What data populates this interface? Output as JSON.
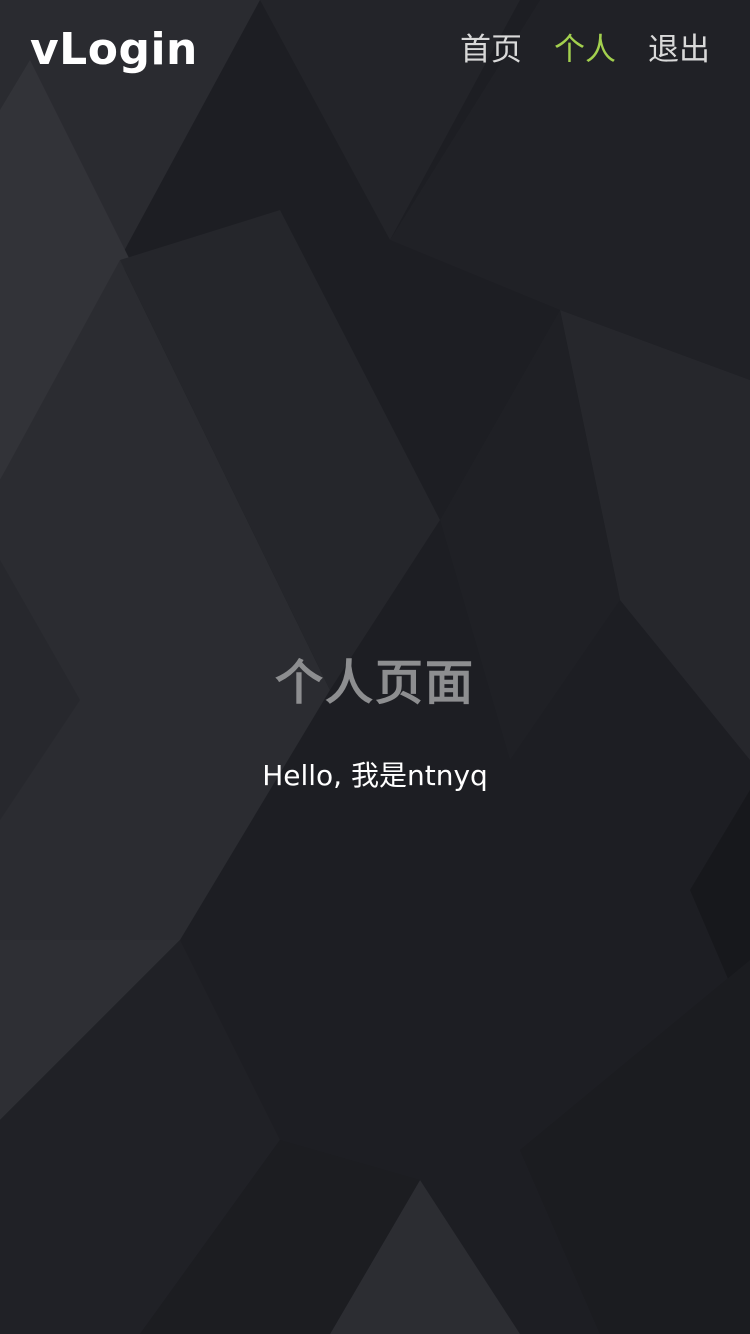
{
  "header": {
    "brand": "vLogin",
    "nav": [
      {
        "label": "首页",
        "active": false
      },
      {
        "label": "个人",
        "active": true
      },
      {
        "label": "退出",
        "active": false
      }
    ],
    "accent_color": "#a3d04e"
  },
  "main": {
    "title": "个人页面",
    "greeting": "Hello, 我是ntnyq"
  }
}
